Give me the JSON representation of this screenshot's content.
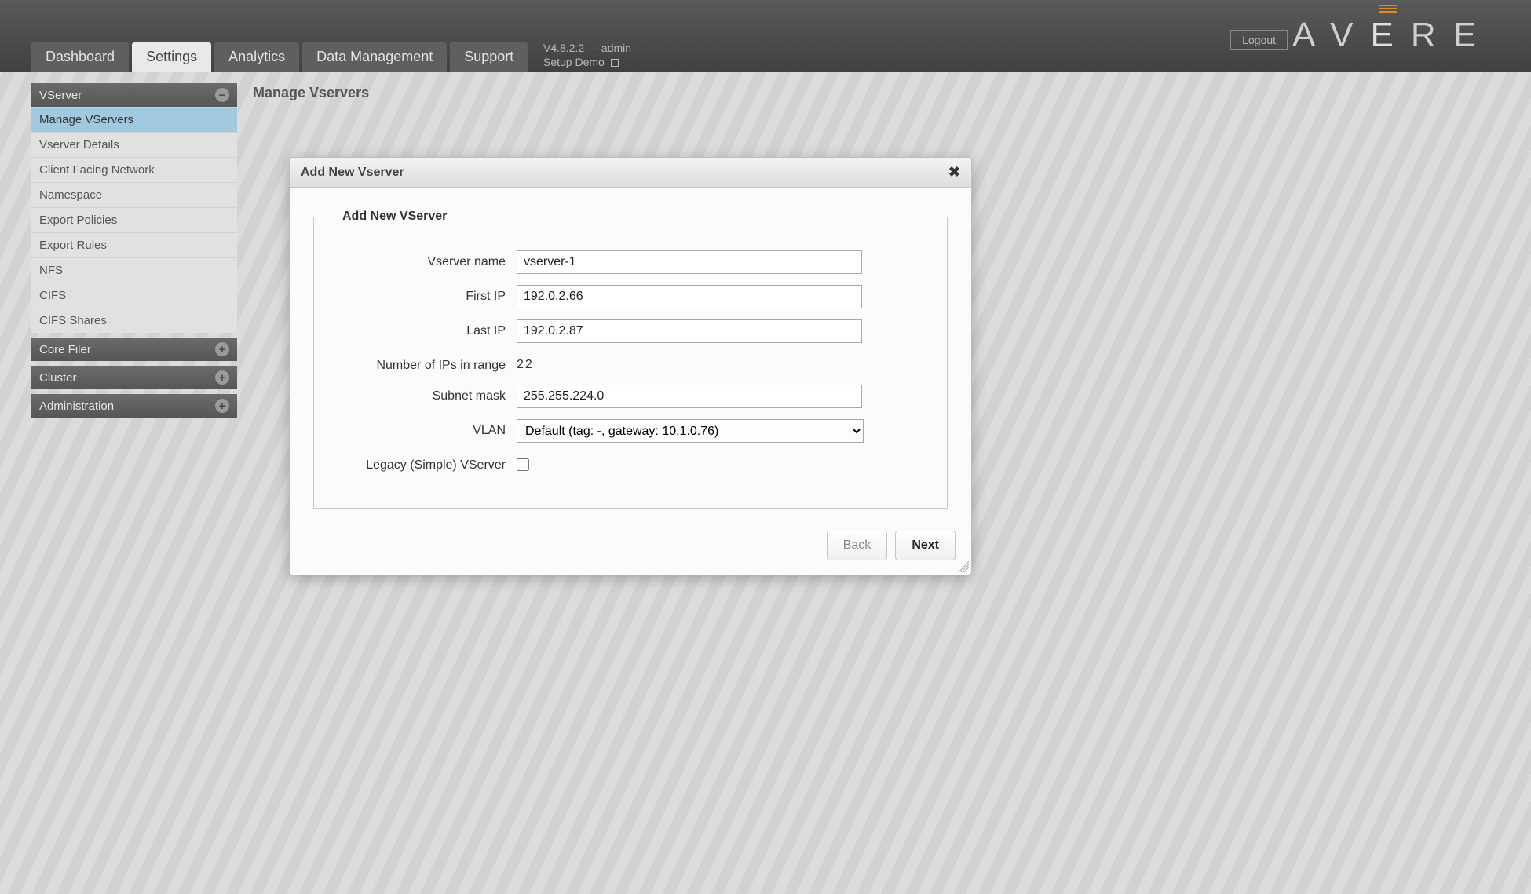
{
  "header": {
    "logout": "Logout",
    "brand_segments": [
      "A",
      "V",
      "E",
      "R",
      "E"
    ],
    "version_line": "V4.8.2.2 --- admin",
    "demo_line": "Setup Demo",
    "tabs": [
      {
        "label": "Dashboard",
        "active": false
      },
      {
        "label": "Settings",
        "active": true
      },
      {
        "label": "Analytics",
        "active": false
      },
      {
        "label": "Data Management",
        "active": false
      },
      {
        "label": "Support",
        "active": false
      }
    ]
  },
  "sidebar": {
    "groups": [
      {
        "label": "VServer",
        "icon": "minus",
        "items": [
          {
            "label": "Manage VServers",
            "active": true
          },
          {
            "label": "Vserver Details",
            "active": false
          },
          {
            "label": "Client Facing Network",
            "active": false
          },
          {
            "label": "Namespace",
            "active": false
          },
          {
            "label": "Export Policies",
            "active": false
          },
          {
            "label": "Export Rules",
            "active": false
          },
          {
            "label": "NFS",
            "active": false
          },
          {
            "label": "CIFS",
            "active": false
          },
          {
            "label": "CIFS Shares",
            "active": false
          }
        ]
      },
      {
        "label": "Core Filer",
        "icon": "plus",
        "items": []
      },
      {
        "label": "Cluster",
        "icon": "plus",
        "items": []
      },
      {
        "label": "Administration",
        "icon": "plus",
        "items": []
      }
    ]
  },
  "page": {
    "title": "Manage Vservers"
  },
  "modal": {
    "title": "Add New Vserver",
    "legend": "Add New VServer",
    "labels": {
      "vserver_name": "Vserver name",
      "first_ip": "First IP",
      "last_ip": "Last IP",
      "num_ips": "Number of IPs in range",
      "subnet_mask": "Subnet mask",
      "vlan": "VLAN",
      "legacy": "Legacy (Simple) VServer"
    },
    "fields": {
      "vserver_name": "vserver-1",
      "first_ip": "192.0.2.66",
      "last_ip": "192.0.2.87",
      "num_ips": "22",
      "subnet_mask": "255.255.224.0",
      "vlan_selected": "Default (tag: -, gateway: 10.1.0.76)",
      "legacy_checked": false
    },
    "buttons": {
      "back": "Back",
      "next": "Next"
    }
  }
}
